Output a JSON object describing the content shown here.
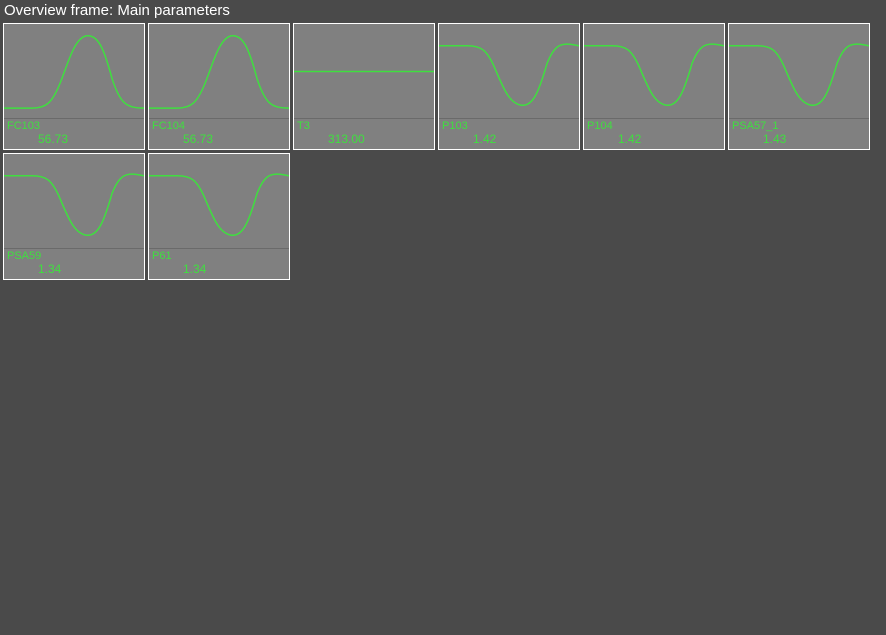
{
  "header": {
    "title": "Overview frame: Main parameters"
  },
  "tiles": [
    {
      "name": "FC103",
      "value": "56.73",
      "shape": "bump"
    },
    {
      "name": "FC104",
      "value": "56.73",
      "shape": "bump"
    },
    {
      "name": "T3",
      "value": "313.00",
      "shape": "flat"
    },
    {
      "name": "P103",
      "value": "1.42",
      "shape": "dip"
    },
    {
      "name": "P104",
      "value": "1.42",
      "shape": "dip"
    },
    {
      "name": "PSA57_1",
      "value": "1.43",
      "shape": "dip"
    },
    {
      "name": "PSA59",
      "value": "1.34",
      "shape": "dip"
    },
    {
      "name": "P61",
      "value": "1.34",
      "shape": "dip"
    }
  ],
  "colors": {
    "accent": "#3fdf3f",
    "tile_bg": "#808080",
    "page_bg": "#4a4a4a"
  },
  "chart_data": [
    {
      "type": "line",
      "title": "FC103",
      "value_label": "56.73",
      "x": [
        0,
        10,
        20,
        30,
        40,
        50,
        60,
        70,
        80,
        90,
        100
      ],
      "y": [
        90,
        90,
        90,
        80,
        50,
        18,
        12,
        25,
        65,
        90,
        90
      ]
    },
    {
      "type": "line",
      "title": "FC104",
      "value_label": "56.73",
      "x": [
        0,
        10,
        20,
        30,
        40,
        50,
        60,
        70,
        80,
        90,
        100
      ],
      "y": [
        90,
        90,
        90,
        80,
        50,
        18,
        12,
        25,
        65,
        90,
        90
      ]
    },
    {
      "type": "line",
      "title": "T3",
      "value_label": "313.00",
      "x": [
        0,
        100
      ],
      "y": [
        50,
        50
      ]
    },
    {
      "type": "line",
      "title": "P103",
      "value_label": "1.42",
      "x": [
        0,
        10,
        20,
        30,
        40,
        50,
        60,
        70,
        80,
        90,
        100
      ],
      "y": [
        22,
        22,
        22,
        25,
        45,
        78,
        85,
        70,
        35,
        18,
        22
      ]
    },
    {
      "type": "line",
      "title": "P104",
      "value_label": "1.42",
      "x": [
        0,
        10,
        20,
        30,
        40,
        50,
        60,
        70,
        80,
        90,
        100
      ],
      "y": [
        22,
        22,
        22,
        25,
        45,
        78,
        85,
        70,
        35,
        18,
        22
      ]
    },
    {
      "type": "line",
      "title": "PSA57_1",
      "value_label": "1.43",
      "x": [
        0,
        10,
        20,
        30,
        40,
        50,
        60,
        70,
        80,
        90,
        100
      ],
      "y": [
        22,
        22,
        22,
        25,
        45,
        78,
        85,
        70,
        35,
        18,
        22
      ]
    },
    {
      "type": "line",
      "title": "PSA59",
      "value_label": "1.34",
      "x": [
        0,
        10,
        20,
        30,
        40,
        50,
        60,
        70,
        80,
        90,
        100
      ],
      "y": [
        22,
        22,
        22,
        25,
        45,
        78,
        85,
        70,
        35,
        18,
        22
      ]
    },
    {
      "type": "line",
      "title": "P61",
      "value_label": "1.34",
      "x": [
        0,
        10,
        20,
        30,
        40,
        50,
        60,
        70,
        80,
        90,
        100
      ],
      "y": [
        22,
        22,
        22,
        25,
        45,
        78,
        85,
        70,
        35,
        18,
        22
      ]
    }
  ]
}
